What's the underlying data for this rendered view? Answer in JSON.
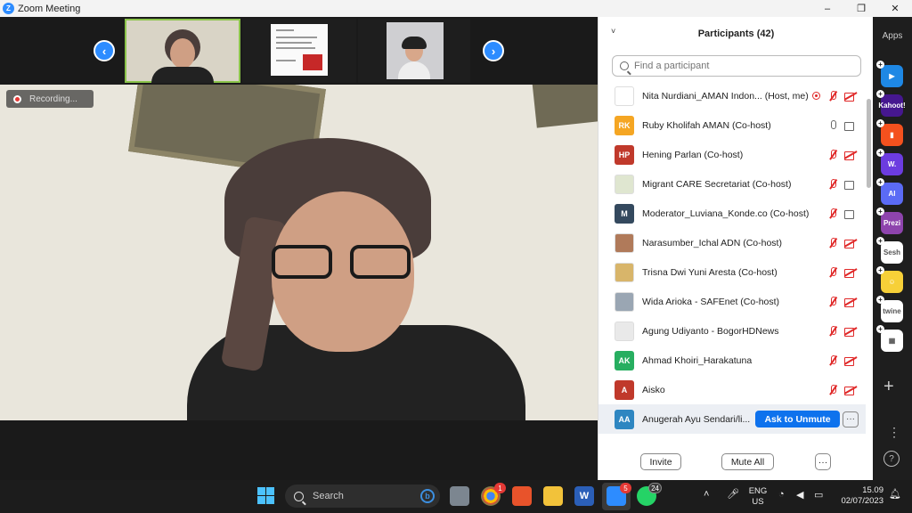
{
  "window": {
    "title": "Zoom Meeting",
    "minimize": "–",
    "restore": "❐",
    "close": "✕"
  },
  "meeting": {
    "recording_label": "Recording...",
    "prev_arrow": "‹",
    "next_arrow": "›"
  },
  "participants_panel": {
    "title": "Participants (42)",
    "collapse_glyph": "˅",
    "search_placeholder": "Find a participant",
    "participants": [
      {
        "initials": "",
        "name": "Nita Nurdiani_AMAN Indon... (Host, me)",
        "avatar_color": "#ffffff",
        "mic": "off",
        "cam": "off",
        "recording": true
      },
      {
        "initials": "RK",
        "name": "Ruby Kholifah AMAN (Co-host)",
        "avatar_color": "#f5a623",
        "mic": "on",
        "cam": "on",
        "recording": false
      },
      {
        "initials": "HP",
        "name": "Hening Parlan (Co-host)",
        "avatar_color": "#c0392b",
        "mic": "off",
        "cam": "off",
        "recording": false
      },
      {
        "initials": "",
        "name": "Migrant CARE Secretariat (Co-host)",
        "avatar_color": "#dfe6d0",
        "mic": "off",
        "cam": "on",
        "recording": false
      },
      {
        "initials": "M",
        "name": "Moderator_Luviana_Konde.co (Co-host)",
        "avatar_color": "#34495e",
        "mic": "off",
        "cam": "on",
        "recording": false
      },
      {
        "initials": "",
        "name": "Narasumber_Ichal ADN (Co-host)",
        "avatar_color": "#b07a5a",
        "mic": "off",
        "cam": "off",
        "recording": false
      },
      {
        "initials": "",
        "name": "Trisna Dwi Yuni Aresta (Co-host)",
        "avatar_color": "#d8b56a",
        "mic": "off",
        "cam": "off",
        "recording": false
      },
      {
        "initials": "",
        "name": "Wida Arioka - SAFEnet (Co-host)",
        "avatar_color": "#9aa6b3",
        "mic": "off",
        "cam": "off",
        "recording": false
      },
      {
        "initials": "",
        "name": "Agung Udiyanto - BogorHDNews",
        "avatar_color": "#e9e9e9",
        "mic": "off",
        "cam": "off",
        "recording": false
      },
      {
        "initials": "AK",
        "name": "Ahmad Khoiri_Harakatuna",
        "avatar_color": "#27ae60",
        "mic": "off",
        "cam": "off",
        "recording": false
      },
      {
        "initials": "A",
        "name": "Aisko",
        "avatar_color": "#c0392b",
        "mic": "off",
        "cam": "off",
        "recording": false
      },
      {
        "initials": "AA",
        "name": "Anugerah Ayu Sendari/li...",
        "avatar_color": "#2e86c1",
        "mic": "off",
        "cam": "off",
        "recording": false
      }
    ],
    "ask_to_unmute": "Ask to Unmute",
    "row_more": "···",
    "invite_label": "Invite",
    "mute_all_label": "Mute All",
    "footer_more": "···"
  },
  "apps_sidebar": {
    "label": "Apps",
    "apps": [
      {
        "name": "app-1",
        "color": "#1e88e5",
        "glyph": "▶"
      },
      {
        "name": "kahoot",
        "color": "#46178f",
        "glyph": "Kahoot!"
      },
      {
        "name": "app-3",
        "color": "#f4511e",
        "glyph": "▮"
      },
      {
        "name": "wooclap",
        "color": "#6c3ce0",
        "glyph": "W."
      },
      {
        "name": "ai-app",
        "color": "#5b6bf5",
        "glyph": "AI"
      },
      {
        "name": "prezi",
        "color": "#8e44ad",
        "glyph": "Prezi"
      },
      {
        "name": "sesh",
        "color": "#ffffff",
        "glyph": "Sesh"
      },
      {
        "name": "smiley-app",
        "color": "#f7d038",
        "glyph": "☺"
      },
      {
        "name": "twine",
        "color": "#ffffff",
        "glyph": "twine"
      },
      {
        "name": "apps-grid",
        "color": "#ffffff",
        "glyph": "▦"
      }
    ],
    "add_glyph": "+",
    "more_glyph": "⋮",
    "help_glyph": "?"
  },
  "taskbar": {
    "search_placeholder": "Search",
    "bing_glyph": "b",
    "chrome_badge": "1",
    "zoom_badge": "5",
    "whatsapp_badge": "24",
    "lang_line1": "ENG",
    "lang_line2": "US",
    "time": "15.09",
    "date": "02/07/2023",
    "up_arrow": "˄"
  }
}
